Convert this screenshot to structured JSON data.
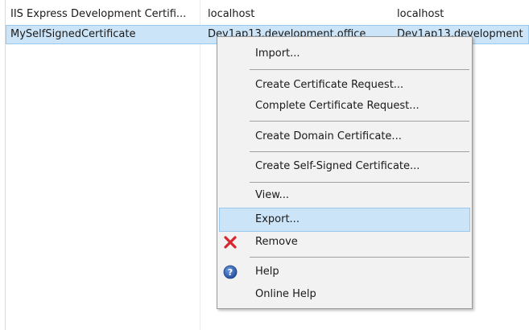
{
  "certificates": [
    {
      "name": "IIS Express Development Certifi...",
      "issued_to": "localhost",
      "issued_by": "localhost"
    },
    {
      "name": "MySelfSignedCertificate",
      "issued_to": "Dev1ap13.development.office",
      "issued_by": "Dev1ap13.development"
    }
  ],
  "context_menu": {
    "items": [
      {
        "label": "Import...",
        "icon": ""
      },
      {
        "label": "Create Certificate Request...",
        "icon": ""
      },
      {
        "label": "Complete Certificate Request...",
        "icon": ""
      },
      {
        "label": "Create Domain Certificate...",
        "icon": ""
      },
      {
        "label": "Create Self-Signed Certificate...",
        "icon": ""
      },
      {
        "label": "View...",
        "icon": ""
      },
      {
        "label": "Export...",
        "icon": "",
        "highlighted": true
      },
      {
        "label": "Remove",
        "icon": "remove-icon"
      },
      {
        "label": "Help",
        "icon": "help-icon"
      },
      {
        "label": "Online Help",
        "icon": ""
      }
    ]
  },
  "colors": {
    "selection_bg": "#cce4f7",
    "selection_border": "#99c9ef",
    "menu_bg": "#f2f2f2",
    "remove_red": "#d8262f",
    "help_blue": "#2f5da8"
  }
}
